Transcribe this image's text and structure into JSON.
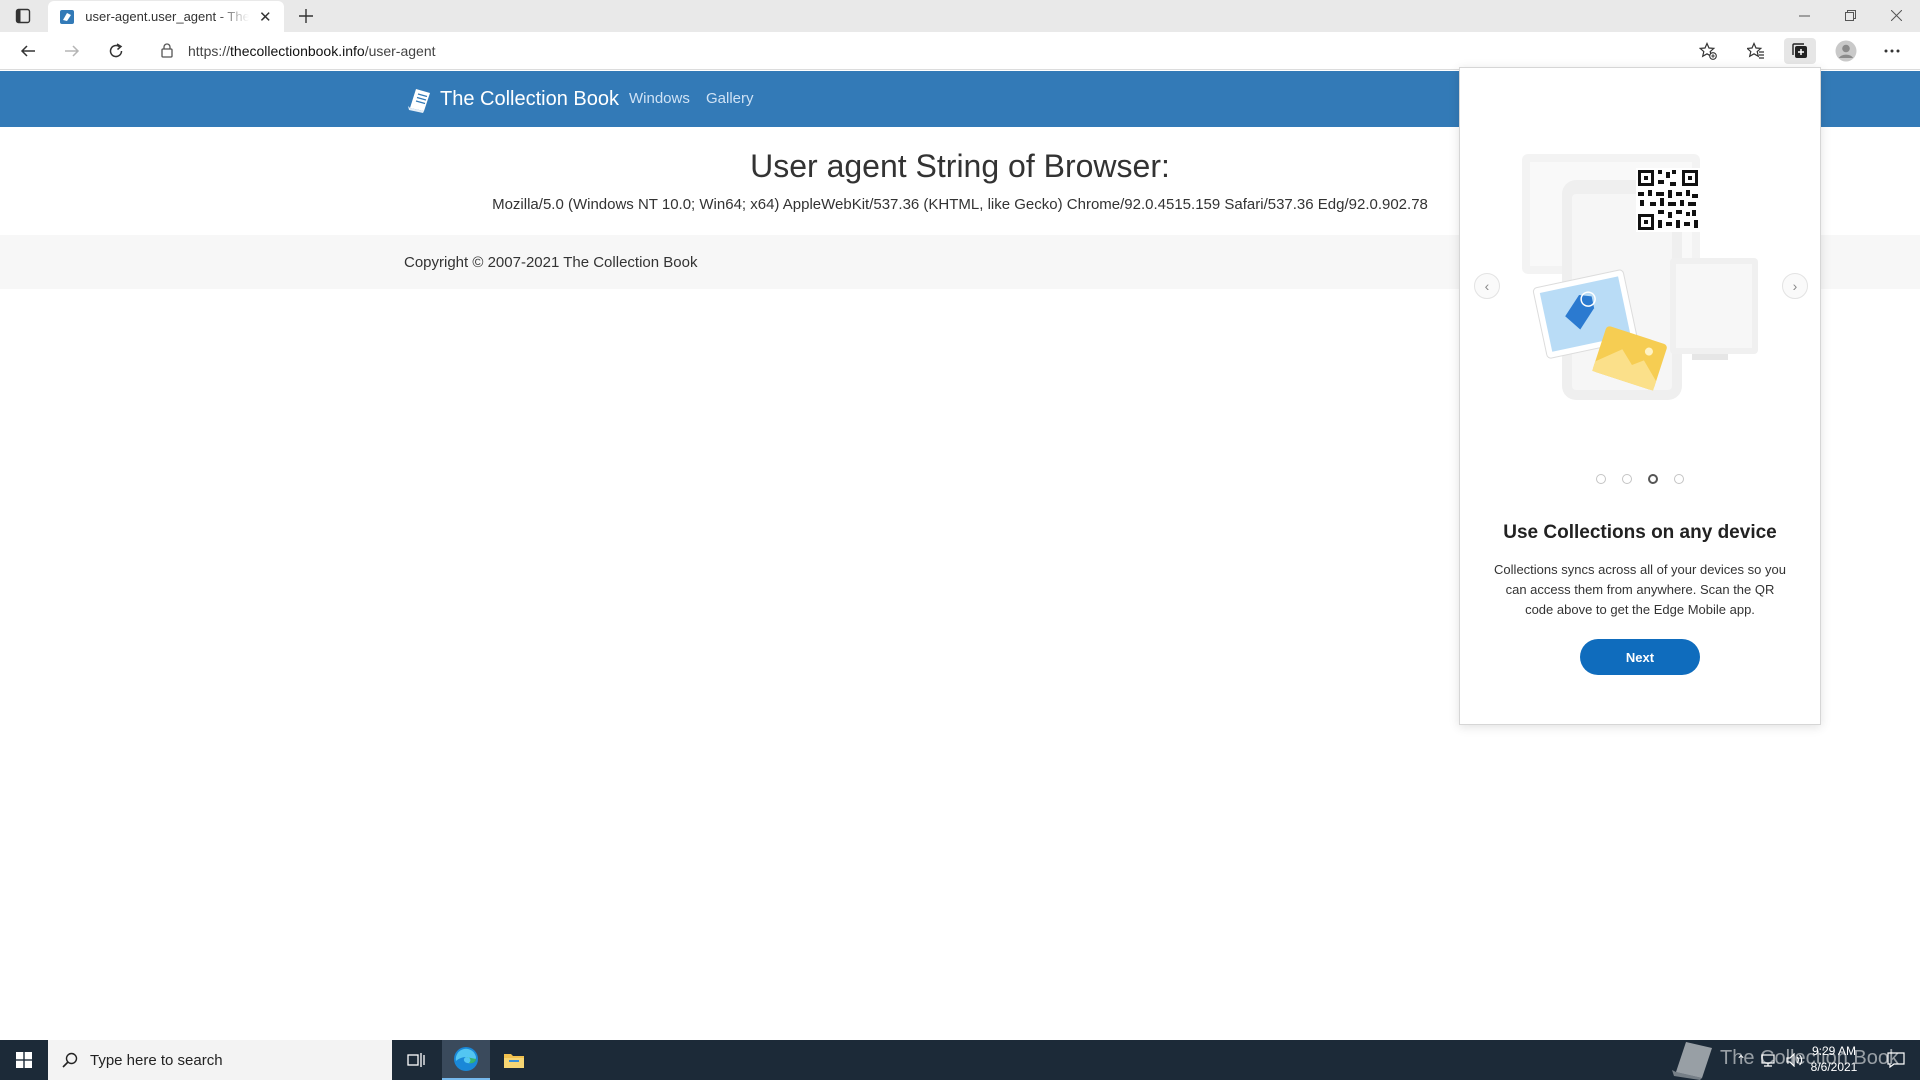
{
  "browser": {
    "tab": {
      "title": "user-agent.user_agent - The Collection Book"
    },
    "address_bar": {
      "scheme": "https://",
      "host": "thecollectionbook.info",
      "path": "/user-agent"
    }
  },
  "site": {
    "brand": "The Collection Book",
    "nav": [
      "Windows",
      "Gallery"
    ],
    "heading": "User agent String of Browser:",
    "user_agent": "Mozilla/5.0 (Windows NT 10.0; Win64; x64) AppleWebKit/537.36 (KHTML, like Gecko) Chrome/92.0.4515.159 Safari/537.36 Edg/92.0.902.78",
    "copyright": "Copyright © 2007-2021 The Collection Book"
  },
  "collections_flyout": {
    "title": "Use Collections on any device",
    "body": "Collections syncs across all of your devices so you can access them from anywhere. Scan the QR code above to get the Edge Mobile app.",
    "next_label": "Next",
    "carousel": {
      "total": 4,
      "active_index": 3
    }
  },
  "taskbar": {
    "search_placeholder": "Type here to search",
    "time": "9:29 AM",
    "date": "8/6/2021",
    "watermark": "The Collection Book"
  },
  "colors": {
    "site_header": "#337ab7",
    "next_button": "#0f6cbd",
    "taskbar": "#1c2a38"
  },
  "icons": {
    "tab_actions": "tab-actions-icon",
    "back": "back-arrow-icon",
    "forward": "forward-arrow-icon",
    "refresh": "refresh-icon",
    "lock": "lock-icon",
    "add_favorite": "star-add-icon",
    "favorites": "favorites-icon",
    "collections": "collections-icon",
    "profile": "profile-icon",
    "more": "more-icon"
  }
}
